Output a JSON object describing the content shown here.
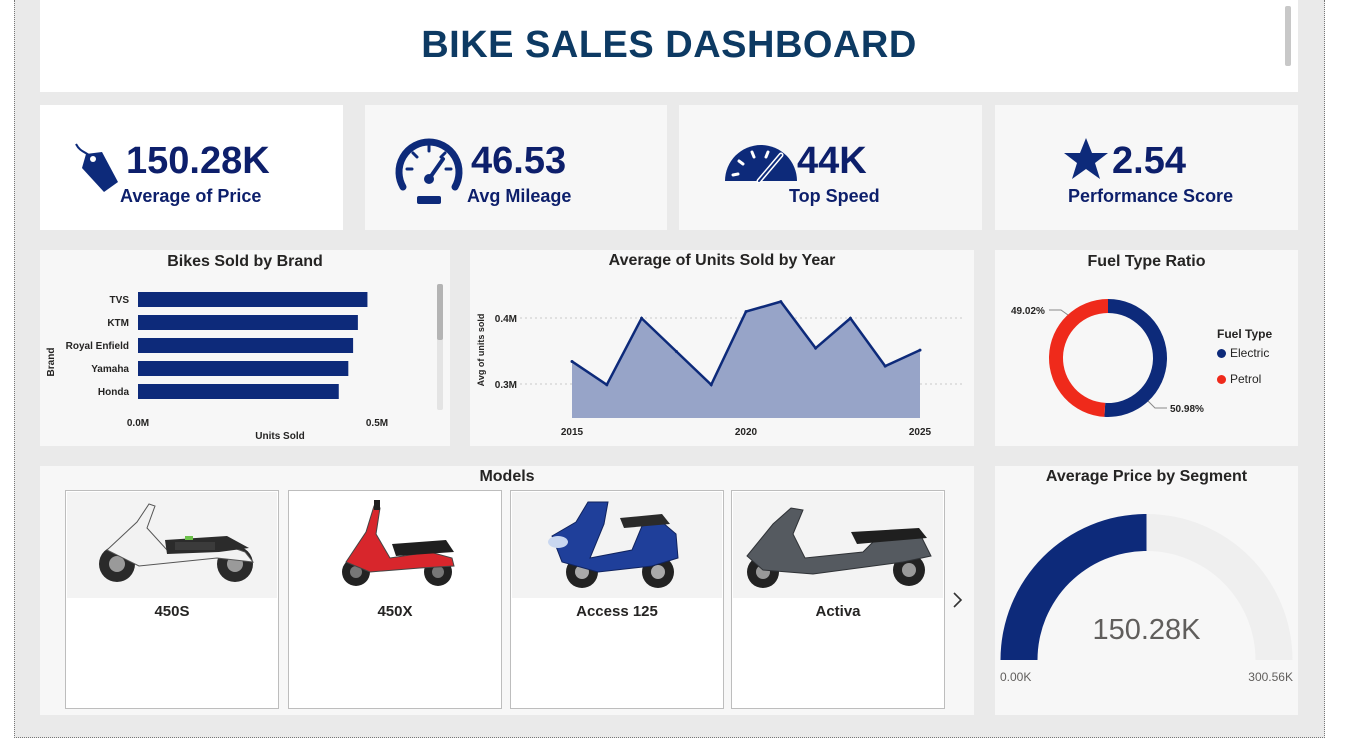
{
  "dashboard": {
    "title": "BIKE SALES DASHBOARD"
  },
  "kpis": [
    {
      "value": "150.28K",
      "label": "Average of Price",
      "icon": "price-tag-icon"
    },
    {
      "value": "46.53",
      "label": "Avg Mileage",
      "icon": "speedometer-icon"
    },
    {
      "value": "44K",
      "label": "Top Speed",
      "icon": "gauge-icon"
    },
    {
      "value": "2.54",
      "label": "Performance Score",
      "icon": "star-icon"
    }
  ],
  "colors": {
    "navy": "#0d2a7a",
    "kpi_text": "#0d1f6b",
    "title": "#0d3a63",
    "area": "#97a4c8",
    "petrol": "#ef2a1b",
    "gauge_track": "#efefef"
  },
  "brand_chart": {
    "title": "Bikes Sold by Brand",
    "xlabel": "Units Sold",
    "ylabel": "Brand",
    "x_ticks": [
      "0.0M",
      "0.5M"
    ]
  },
  "year_chart": {
    "title": "Average of Units Sold by Year",
    "ylabel": "Avg of units sold",
    "y_ticks": [
      "0.4M",
      "0.3M"
    ],
    "x_ticks": [
      "2015",
      "2020",
      "2025"
    ]
  },
  "fuel_chart": {
    "title": "Fuel Type Ratio",
    "legend_title": "Fuel Type",
    "legend": [
      "Electric",
      "Petrol"
    ],
    "labels": [
      "49.02%",
      "50.98%"
    ]
  },
  "models": {
    "title": "Models",
    "items": [
      "450S",
      "450X",
      "Access 125",
      "Activa"
    ],
    "next_icon": "chevron-right-icon"
  },
  "segment_gauge": {
    "title": "Average Price by Segment",
    "value": "150.28K",
    "min": "0.00K",
    "max": "300.56K"
  },
  "chart_data": [
    {
      "type": "bar",
      "title": "Bikes Sold by Brand",
      "categories": [
        "TVS",
        "KTM",
        "Royal Enfield",
        "Yamaha",
        "Honda"
      ],
      "values": [
        0.48,
        0.46,
        0.45,
        0.44,
        0.42
      ],
      "xlabel": "Units Sold",
      "ylabel": "Brand",
      "xlim": [
        0,
        0.5
      ],
      "orientation": "horizontal",
      "value_unit": "M"
    },
    {
      "type": "area",
      "title": "Average of Units Sold by Year",
      "x": [
        2015,
        2016,
        2017,
        2018,
        2019,
        2020,
        2021,
        2022,
        2023,
        2024,
        2025
      ],
      "values": [
        0.335,
        0.3,
        0.4,
        0.35,
        0.3,
        0.41,
        0.425,
        0.355,
        0.4,
        0.328,
        0.352
      ],
      "ylabel": "Avg of units sold",
      "ylim": [
        0.25,
        0.45
      ],
      "value_unit": "M"
    },
    {
      "type": "pie",
      "title": "Fuel Type Ratio",
      "categories": [
        "Electric",
        "Petrol"
      ],
      "values": [
        50.98,
        49.02
      ],
      "donut": true
    },
    {
      "type": "gauge",
      "title": "Average Price by Segment",
      "value": 150.28,
      "min": 0,
      "max": 300.56,
      "unit": "K"
    }
  ]
}
